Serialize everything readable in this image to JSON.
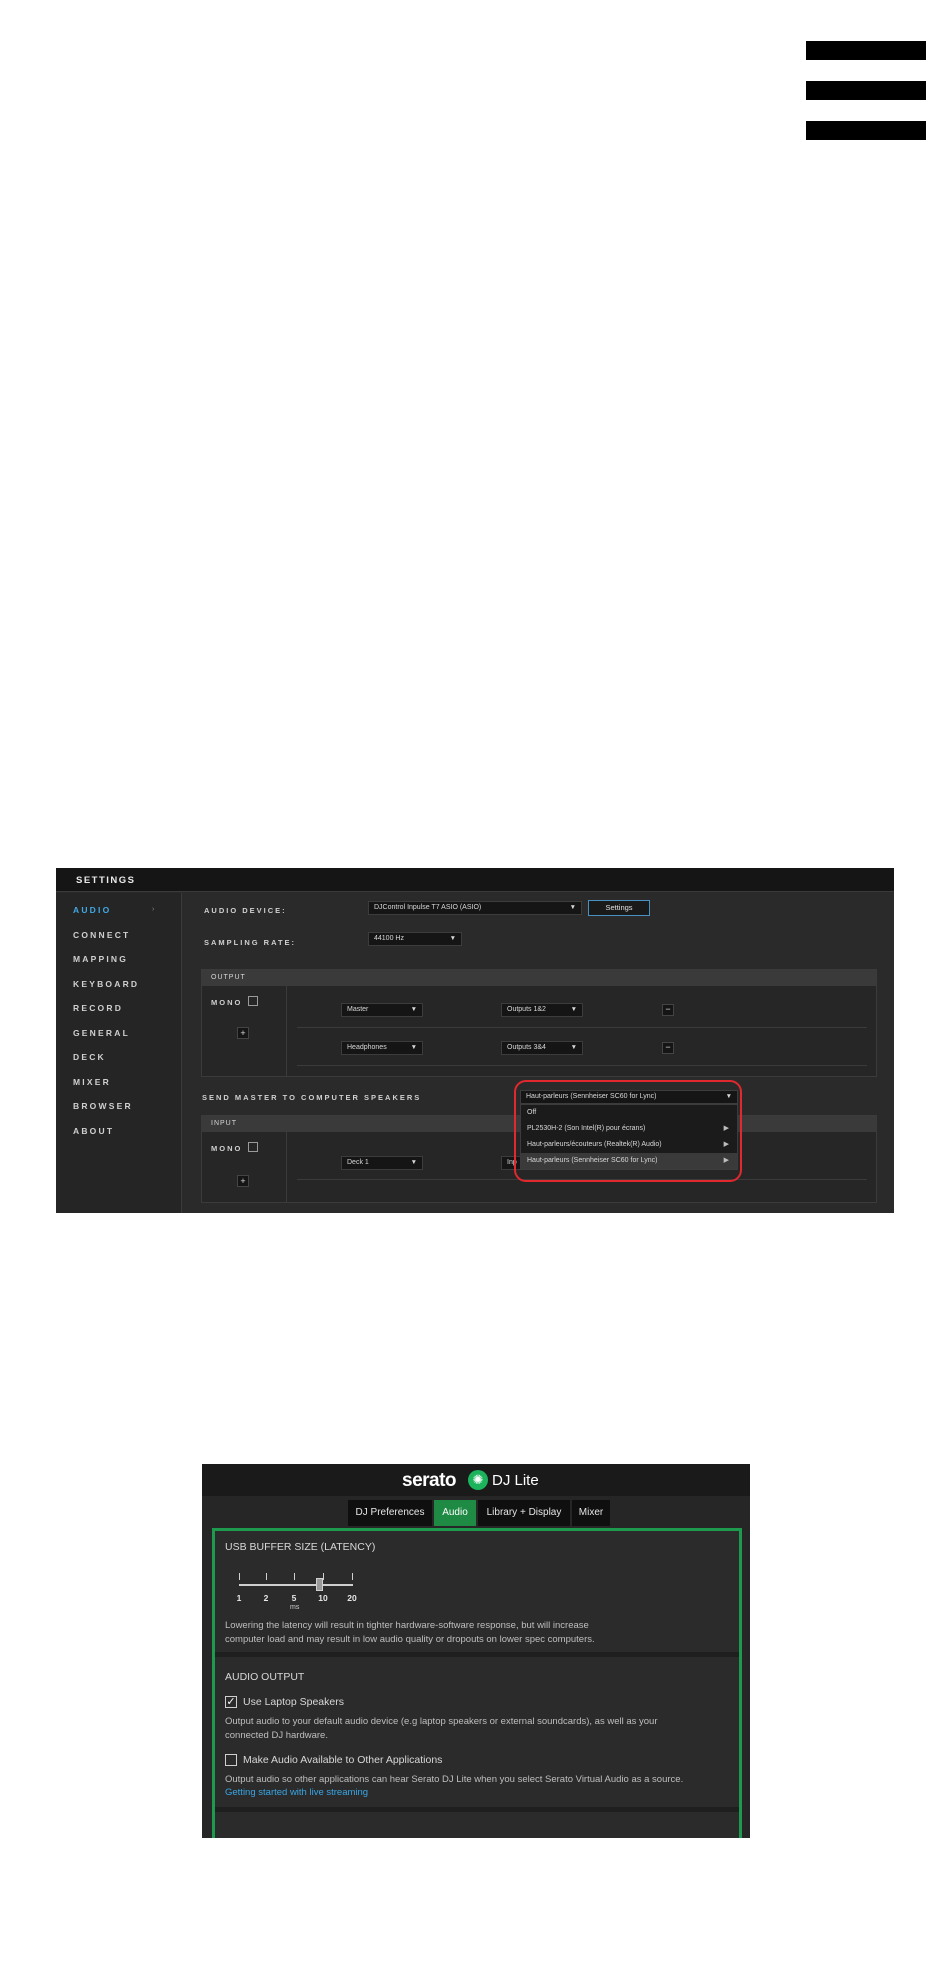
{
  "settings": {
    "title": "SETTINGS",
    "sidebar": [
      {
        "label": "AUDIO"
      },
      {
        "label": "CONNECT"
      },
      {
        "label": "MAPPING"
      },
      {
        "label": "KEYBOARD"
      },
      {
        "label": "RECORD"
      },
      {
        "label": "GENERAL"
      },
      {
        "label": "DECK"
      },
      {
        "label": "MIXER"
      },
      {
        "label": "BROWSER"
      },
      {
        "label": "ABOUT"
      }
    ],
    "sidebar_caret": "›",
    "audio_device_label": "AUDIO DEVICE:",
    "audio_device_value": "DJControl Inpulse T7 ASIO (ASIO)",
    "settings_button": "Settings",
    "sampling_rate_label": "SAMPLING RATE:",
    "sampling_rate_value": "44100 Hz",
    "output_header": "OUTPUT",
    "mono_label": "MONO",
    "plus": "+",
    "minus": "−",
    "output_rows": [
      {
        "source": "Master",
        "dest": "Outputs 1&2"
      },
      {
        "source": "Headphones",
        "dest": "Outputs 3&4"
      }
    ],
    "send_master_label": "SEND MASTER TO COMPUTER SPEAKERS",
    "speaker_dropdown_value": "Haut-parleurs (Sennheiser SC60 for Lync)",
    "speaker_menu": [
      {
        "label": "Off"
      },
      {
        "label": "PL2530H-2 (Son Intel(R) pour écrans)"
      },
      {
        "label": "Haut-parleurs/écouteurs (Realtek(R) Audio)"
      },
      {
        "label": "Haut-parleurs (Sennheiser SC60 for Lync)"
      }
    ],
    "submenu_arrow": "▶",
    "input_header": "INPUT",
    "input_row": {
      "source": "Deck 1",
      "dest_partial": "Inp"
    },
    "caret": "▼"
  },
  "serato": {
    "logo_word": "serato",
    "logo_suffix": "DJ Lite",
    "tabs": [
      {
        "label": "DJ Preferences"
      },
      {
        "label": "Audio"
      },
      {
        "label": "Library + Display"
      },
      {
        "label": "Mixer"
      }
    ],
    "active_tab": "Audio",
    "usb_buffer_title": "USB BUFFER SIZE (LATENCY)",
    "buffer_ticks": [
      "1",
      "2",
      "5",
      "10",
      "20"
    ],
    "buffer_unit": "ms",
    "buffer_value_ms": 10,
    "buffer_note_line1": "Lowering the latency will result in tighter hardware-software response, but will increase",
    "buffer_note_line2": "computer load and may result in low audio quality or dropouts on lower spec computers.",
    "audio_output_title": "AUDIO OUTPUT",
    "use_laptop_speakers_label": "Use Laptop Speakers",
    "use_laptop_speakers_checked": true,
    "checkmark": "✓",
    "laptop_note_line1": "Output audio to your default audio device (e.g laptop speakers or external soundcards), as well as your",
    "laptop_note_line2": "connected DJ hardware.",
    "make_available_label": "Make Audio Available to Other Applications",
    "make_available_checked": false,
    "make_available_note": "Output audio so other applications can hear Serato DJ Lite when you select Serato Virtual Audio as a source.",
    "streaming_link": "Getting started with live streaming"
  }
}
